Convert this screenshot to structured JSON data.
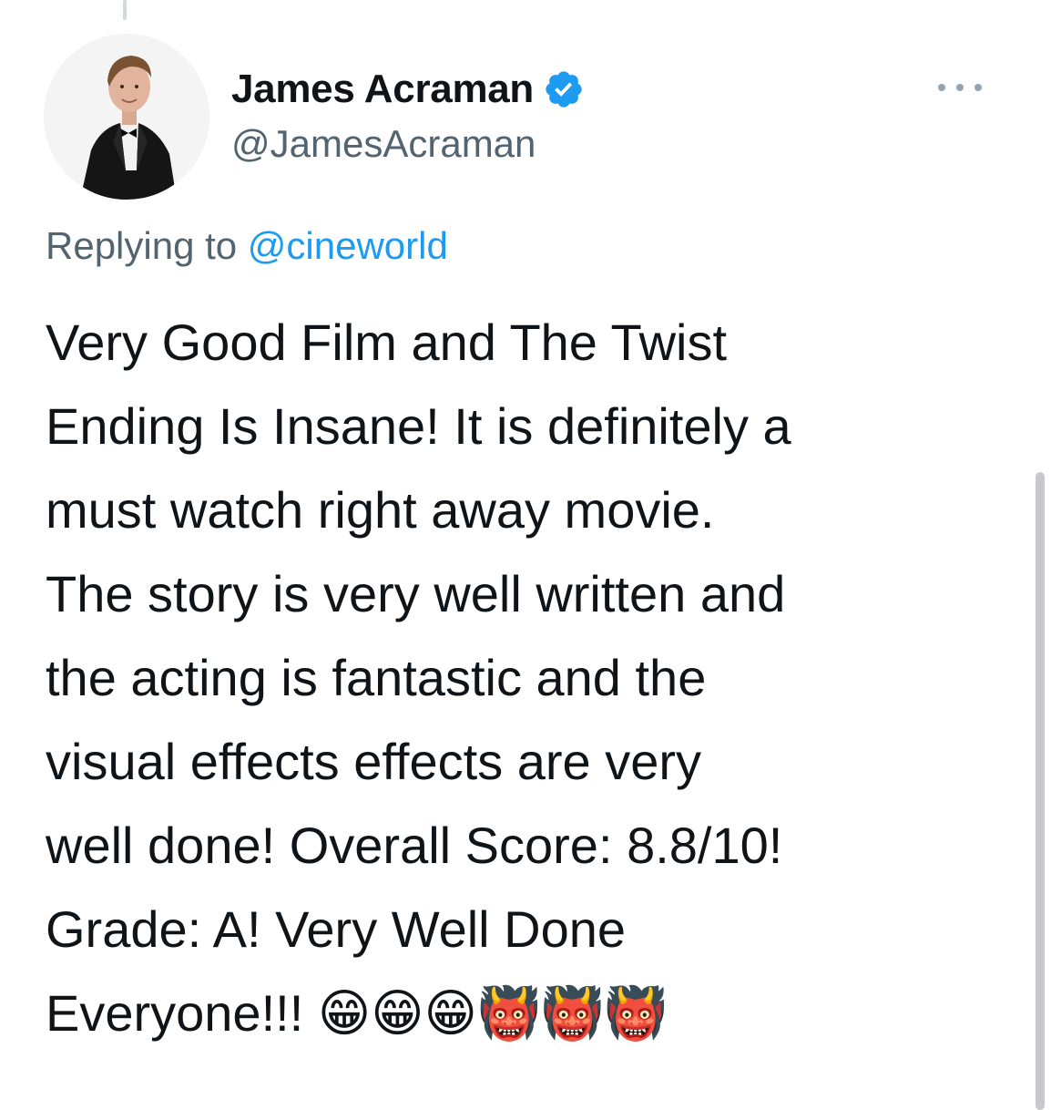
{
  "tweet": {
    "author": {
      "display_name": "James Acraman",
      "handle": "@JamesAcraman",
      "verified": true,
      "avatar_icon": "profile-photo"
    },
    "reply": {
      "prefix": "Replying to ",
      "target": "@cineworld"
    },
    "text": "Very Good Film and The Twist\nEnding Is Insane! It is definitely a\nmust watch right away movie.\nThe story is very well written and\nthe acting is fantastic and the\nvisual effects effects are very\nwell done! Overall Score: 8.8/10!\nGrade: A! Very Well Done\nEveryone!!! 😁😁😁👹👹👹",
    "more_icon": "more-horizontal-icon"
  },
  "colors": {
    "text_primary": "#0f1419",
    "text_secondary": "#536471",
    "link": "#1d9bf0",
    "verified": "#1d9bf0"
  }
}
